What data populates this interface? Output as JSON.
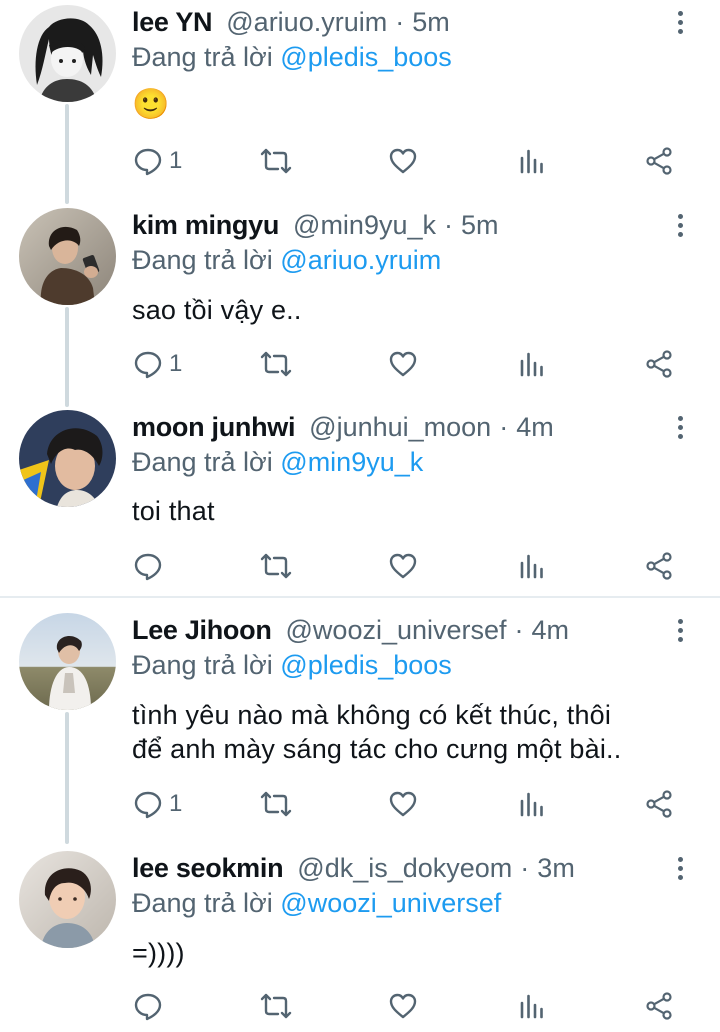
{
  "reply_prefix": "Đang trả lời",
  "colors": {
    "mention": "#1d9bf0",
    "muted": "#536471",
    "thread_line": "#cfd9de"
  },
  "icons": [
    "reply-icon",
    "retweet-icon",
    "like-icon",
    "analytics-icon",
    "share-icon",
    "more-options-icon"
  ],
  "tweets": [
    {
      "name": "lee YN",
      "handle": "@ariuo.yruim",
      "separator": "·",
      "time": "5m",
      "replying_to": "@pledis_boos",
      "text_lines": [
        "🙂"
      ],
      "reply_count": "1",
      "avatar": "cartoon-avatar"
    },
    {
      "name": "kim mingyu",
      "handle": "@min9yu_k",
      "separator": "·",
      "time": "5m",
      "replying_to": "@ariuo.yruim",
      "text_lines": [
        "sao tồi vậy e.."
      ],
      "reply_count": "1",
      "avatar": "photo-avatar"
    },
    {
      "name": "moon junhwi",
      "handle": "@junhui_moon",
      "separator": "·",
      "time": "4m",
      "replying_to": "@min9yu_k",
      "text_lines": [
        "toi that"
      ],
      "reply_count": "",
      "avatar": "photo-avatar"
    },
    {
      "name": "Lee Jihoon",
      "handle": "@woozi_universef",
      "separator": "·",
      "time": "4m",
      "replying_to": "@pledis_boos",
      "text_lines": [
        "tình yêu nào mà không có kết thúc, thôi",
        "để anh mày sáng tác cho cưng một bài.."
      ],
      "reply_count": "1",
      "avatar": "photo-avatar"
    },
    {
      "name": "lee seokmin",
      "handle": "@dk_is_dokyeom",
      "separator": "·",
      "time": "3m",
      "replying_to": "@woozi_universef",
      "text_lines": [
        "=))))"
      ],
      "reply_count": "",
      "avatar": "photo-avatar"
    }
  ]
}
